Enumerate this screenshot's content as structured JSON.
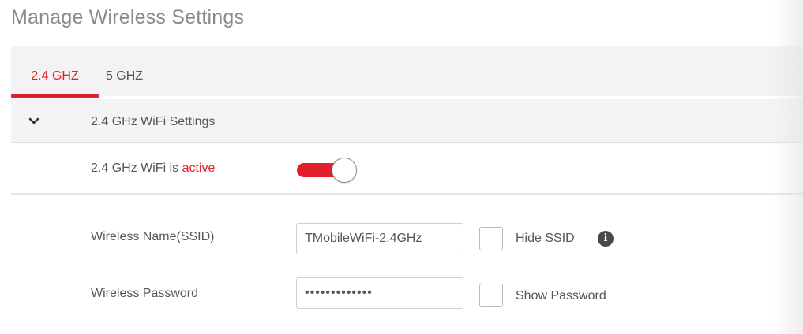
{
  "page": {
    "title": "Manage Wireless Settings"
  },
  "tabs": [
    {
      "label": "2.4 GHZ",
      "active": true
    },
    {
      "label": "5 GHZ",
      "active": false
    }
  ],
  "section": {
    "title": "2.4 GHz WiFi Settings",
    "expanded": true,
    "chevron_icon": "chevron-down-icon"
  },
  "status": {
    "prefix": "2.4 GHz WiFi is ",
    "state": "active",
    "toggle_on": true
  },
  "form": {
    "ssid_label": "Wireless Name(SSID)",
    "ssid_value": "TMobileWiFi-2.4GHz",
    "hide_ssid_label": "Hide SSID",
    "hide_ssid_checked": false,
    "info_icon": "info-icon",
    "password_label": "Wireless Password",
    "password_masked": "•••••••••••••",
    "show_password_label": "Show Password",
    "show_password_checked": false
  },
  "colors": {
    "accent": "#e2202a",
    "text": "#555555",
    "panel": "#f3f3f3"
  }
}
